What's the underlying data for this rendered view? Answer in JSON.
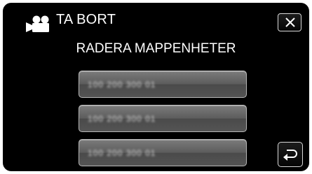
{
  "header": {
    "mode_icon": "video-camera-icon",
    "title": "TA BORT",
    "close_icon": "close-icon"
  },
  "subtitle": "RADERA MAPPENHETER",
  "folders": [
    {
      "label": "100 200 300 01"
    },
    {
      "label": "100 200 300 01"
    },
    {
      "label": "100 200 300 01"
    }
  ],
  "footer": {
    "return_icon": "return-arrow-icon"
  },
  "colors": {
    "background": "#000000",
    "button_gray": "#5c5c5c",
    "text": "#ffffff"
  }
}
